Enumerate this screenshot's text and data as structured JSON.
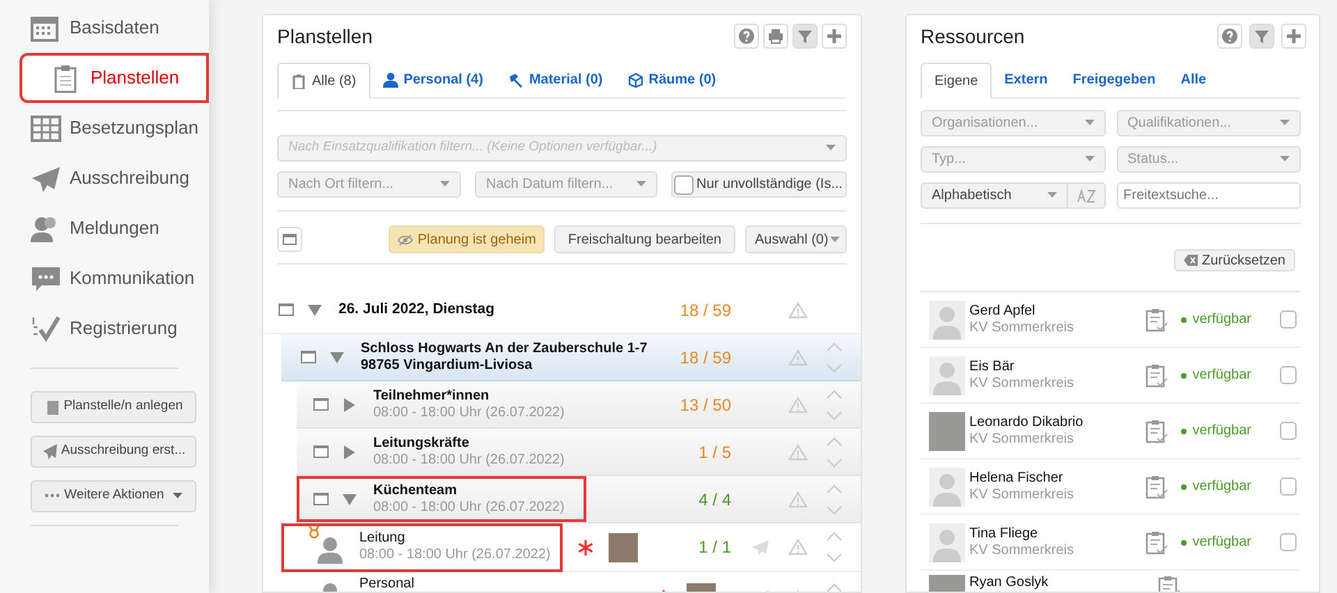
{
  "sidebar": {
    "items": [
      {
        "label": "Basisdaten",
        "selected": false,
        "highlighted": false
      },
      {
        "label": "Planstellen",
        "selected": true,
        "highlighted": true
      },
      {
        "label": "Besetzungsplan",
        "selected": false,
        "highlighted": false
      },
      {
        "label": "Ausschreibung",
        "selected": false,
        "highlighted": false
      },
      {
        "label": "Meldungen",
        "selected": false,
        "highlighted": false
      },
      {
        "label": "Kommunikation",
        "selected": false,
        "highlighted": false
      },
      {
        "label": "Registrierung",
        "selected": false,
        "highlighted": false
      }
    ],
    "actions": [
      "Planstelle/n anlegen",
      "Ausschreibung erst...",
      "Weitere Aktionen"
    ]
  },
  "planstellen": {
    "title": "Planstellen",
    "tabs": [
      {
        "label": "Alle (8)",
        "selected": true
      },
      {
        "label": "Personal (4)",
        "selected": false
      },
      {
        "label": "Material (0)",
        "selected": false
      },
      {
        "label": "Räume (0)",
        "selected": false
      }
    ],
    "qualification_filter": {
      "placeholder": "Nach Einsatzqualifikation filtern... (Keine Optionen verfügbar...)",
      "disabled": true
    },
    "location_filter": {
      "placeholder": "Nach Ort filtern..."
    },
    "date_filter": {
      "placeholder": "Nach Datum filtern..."
    },
    "incomplete_only": {
      "label": "Nur unvollständige (Is...",
      "checked": false
    },
    "secret_badge": "Planung ist geheim",
    "release_button": "Freischaltung bearbeiten",
    "selection_button": "Auswahl (0)",
    "tree": [
      {
        "title": "26. Juli 2022, Dienstag",
        "count": "18 / 59",
        "color": "#e58a28",
        "expanded": true,
        "highlighted": false,
        "children": [
          {
            "title": "Schloss Hogwarts An der Zauberschule 1-7 98765 Vingardium-Liviosa",
            "count": "18 / 59",
            "color": "#e58a28",
            "expanded": true,
            "highlighted": false,
            "children": [
              {
                "title": "Teilnehmer*innen",
                "time": "08:00 - 18:00 Uhr (26.07.2022)",
                "count": "13 / 50",
                "color": "#e58a28",
                "expanded": false,
                "highlighted": false
              },
              {
                "title": "Leitungskräfte",
                "time": "08:00 - 18:00 Uhr (26.07.2022)",
                "count": "1 / 5",
                "color": "#e58a28",
                "expanded": false,
                "highlighted": false
              },
              {
                "title": "Küchenteam",
                "time": "08:00 - 18:00 Uhr (26.07.2022)",
                "count": "4 / 4",
                "color": "#4a9d2a",
                "expanded": true,
                "highlighted": true,
                "children": [
                  {
                    "title": "Leitung",
                    "time": "08:00 - 18:00 Uhr (26.07.2022)",
                    "count": "1 / 1",
                    "color": "#4a9d2a",
                    "lead": true,
                    "highlighted": true
                  },
                  {
                    "title": "Personal",
                    "lead": false,
                    "highlighted": false
                  }
                ]
              }
            ]
          }
        ]
      }
    ]
  },
  "ressourcen": {
    "title": "Ressourcen",
    "tabs": [
      {
        "label": "Eigene",
        "selected": true
      },
      {
        "label": "Extern",
        "selected": false
      },
      {
        "label": "Freigegeben",
        "selected": false
      },
      {
        "label": "Alle",
        "selected": false
      }
    ],
    "filters": [
      {
        "placeholder": "Organisationen..."
      },
      {
        "placeholder": "Qualifikationen..."
      },
      {
        "placeholder": "Typ..."
      },
      {
        "placeholder": "Status..."
      }
    ],
    "sort": "Alphabetisch",
    "search": {
      "placeholder": "Freitextsuche..."
    },
    "reset_button": "Zurücksetzen",
    "people": [
      {
        "name": "Gerd Apfel",
        "org": "KV Sommerkreis",
        "status": "verfügbar",
        "photo": false,
        "checked": false
      },
      {
        "name": "Eis Bär",
        "org": "KV Sommerkreis",
        "status": "verfügbar",
        "photo": false,
        "checked": false
      },
      {
        "name": "Leonardo Dikabrio",
        "org": "KV Sommerkreis",
        "status": "verfügbar",
        "photo": true,
        "checked": false
      },
      {
        "name": "Helena Fischer",
        "org": "KV Sommerkreis",
        "status": "verfügbar",
        "photo": false,
        "checked": false
      },
      {
        "name": "Tina Fliege",
        "org": "KV Sommerkreis",
        "status": "verfügbar",
        "photo": false,
        "checked": false
      },
      {
        "name": "Ryan Goslyk",
        "photo": true
      }
    ]
  }
}
